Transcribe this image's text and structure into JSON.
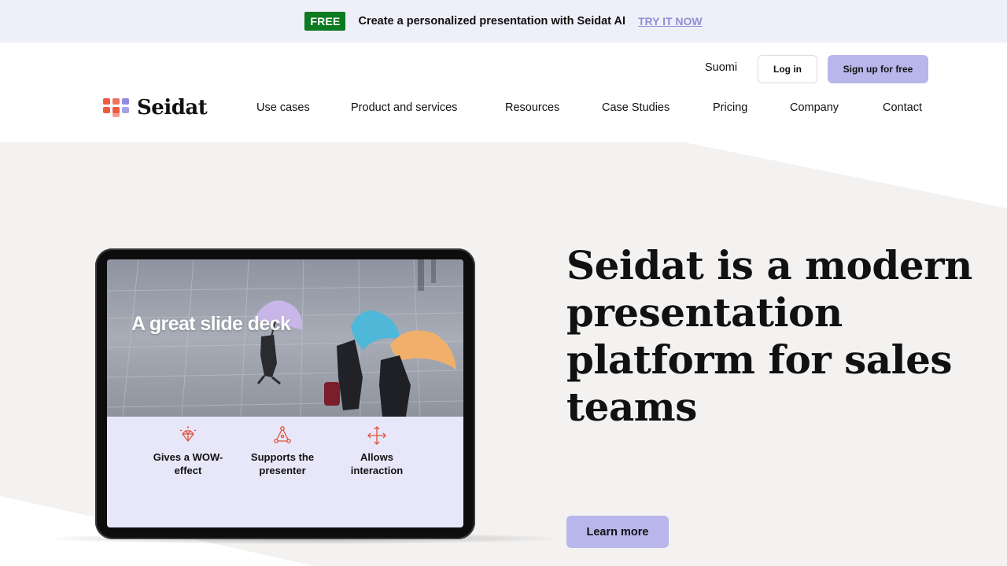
{
  "promo": {
    "badge": "FREE",
    "text": "Create a personalized presentation with Seidat AI",
    "link": "TRY IT NOW",
    "badge_color": "#0b7a20",
    "link_color": "#8f8fd6"
  },
  "header": {
    "language": "Suomi",
    "login_label": "Log in",
    "signup_label": "Sign up for free",
    "logo_text": "Seidat",
    "nav": [
      "Use cases",
      "Product and services",
      "Resources",
      "Case Studies",
      "Pricing",
      "Company",
      "Contact"
    ]
  },
  "hero": {
    "title": "Seidat is a modern presentation platform for sales teams",
    "cta_label": "Learn more",
    "device": {
      "slide_title": "A great slide deck",
      "features": [
        {
          "icon": "diamond-sparkle-icon",
          "label": "Gives a WOW-effect"
        },
        {
          "icon": "presenter-network-icon",
          "label": "Supports the presenter"
        },
        {
          "icon": "move-arrows-icon",
          "label": "Allows interaction"
        }
      ]
    }
  },
  "colors": {
    "accent": "#b8b6ea",
    "hero_bg": "#f3f2f1",
    "promo_bg": "#efeff9",
    "icon_red": "#e0533c"
  }
}
